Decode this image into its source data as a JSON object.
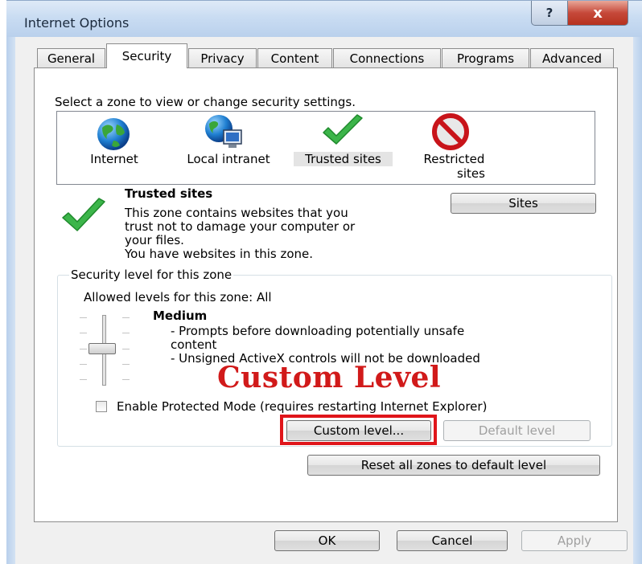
{
  "window": {
    "title": "Internet Options",
    "help_label": "?",
    "close_label": "x"
  },
  "tabs": [
    "General",
    "Security",
    "Privacy",
    "Content",
    "Connections",
    "Programs",
    "Advanced"
  ],
  "security": {
    "zone_prompt": "Select a zone to view or change security settings.",
    "zones": [
      {
        "label": "Internet",
        "icon": "globe-icon"
      },
      {
        "label": "Local intranet",
        "icon": "intranet-icon"
      },
      {
        "label": "Trusted sites",
        "icon": "checkmark-icon"
      },
      {
        "label": "Restricted",
        "label2": "sites",
        "icon": "prohibited-icon"
      }
    ],
    "selected_zone": {
      "title": "Trusted sites",
      "desc_lines": [
        "This zone contains websites that you",
        "trust not to damage your computer or",
        "your files.",
        "You have websites in this zone."
      ],
      "sites_button": "Sites"
    },
    "level_group": {
      "legend": "Security level for this zone",
      "allowed": "Allowed levels for this zone: All",
      "level_name": "Medium",
      "level_lines": [
        "- Prompts before downloading potentially unsafe",
        "content",
        "- Unsigned ActiveX controls will not be downloaded"
      ],
      "overlay_text": "Custom Level",
      "protected_mode_label": "Enable Protected Mode (requires restarting Internet Explorer)",
      "protected_mode_checked": false,
      "custom_level_button": "Custom level...",
      "default_level_button": "Default level"
    },
    "reset_button": "Reset all zones to default level"
  },
  "footer": {
    "ok": "OK",
    "cancel": "Cancel",
    "apply": "Apply"
  },
  "colors": {
    "highlight": "#e0151a",
    "overlay_text": "#d11a1a",
    "titlebar": "#c9dcf2"
  }
}
